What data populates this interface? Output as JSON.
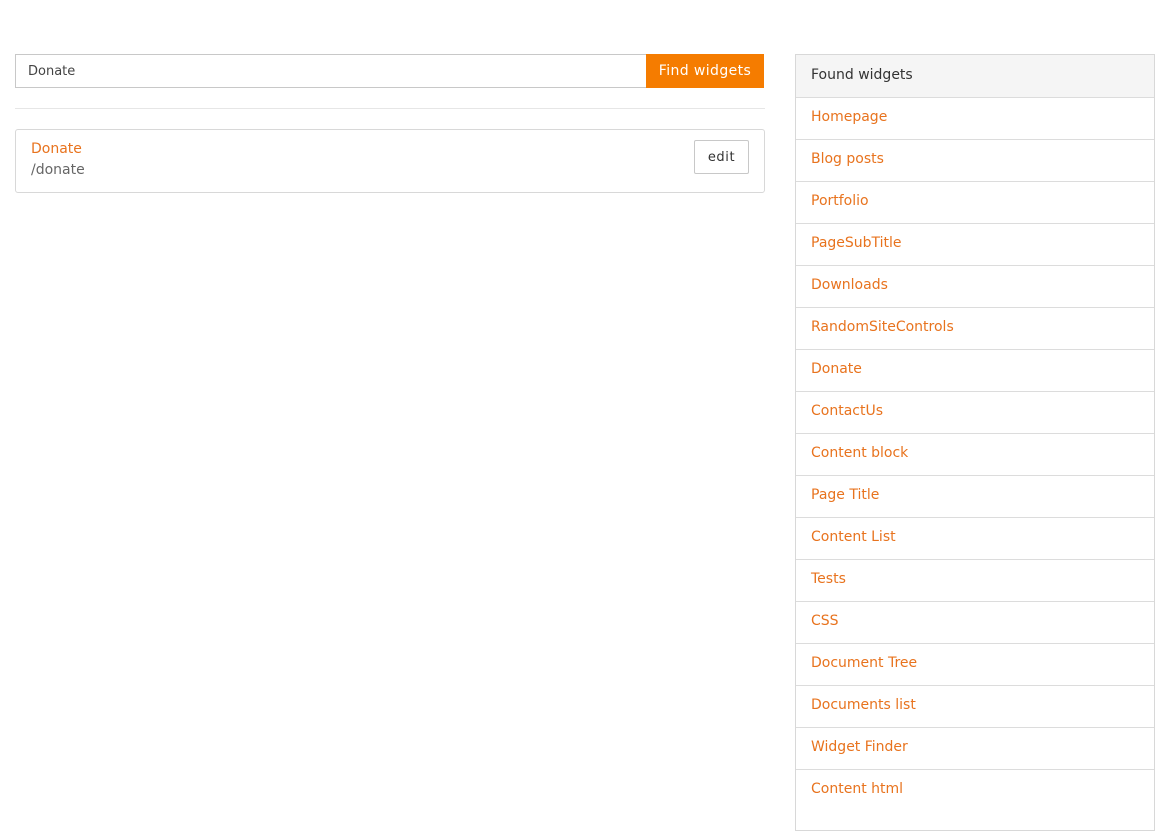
{
  "search": {
    "value": "Donate",
    "button_label": "Find widgets"
  },
  "results": [
    {
      "title": "Donate",
      "path": "/donate",
      "edit_label": "edit"
    }
  ],
  "panel": {
    "header": "Found widgets",
    "items": [
      "Homepage",
      "Blog posts",
      "Portfolio",
      "PageSubTitle",
      "Downloads",
      "RandomSiteControls",
      "Donate",
      "ContactUs",
      "Content block",
      "Page Title",
      "Content List",
      "Tests",
      "CSS",
      "Document Tree",
      "Documents list",
      "Widget Finder",
      "Content html"
    ]
  },
  "colors": {
    "accent": "#f57c00",
    "link": "#e8731e",
    "border": "#d8d8d8"
  }
}
